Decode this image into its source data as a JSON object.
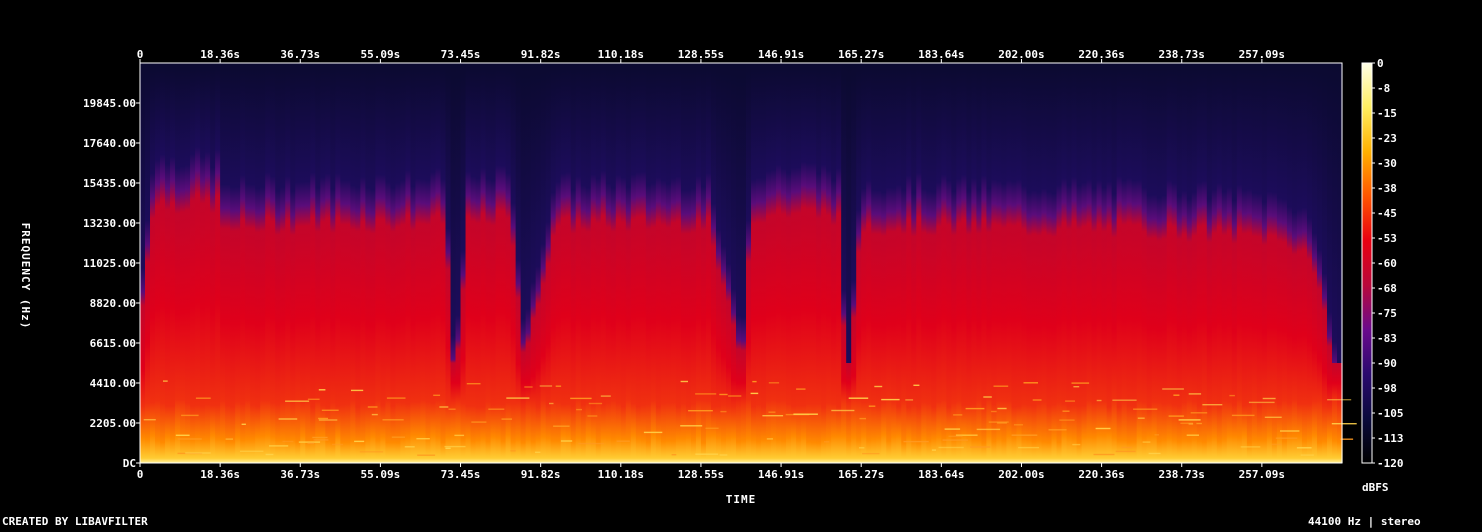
{
  "chart_data": {
    "type": "heatmap",
    "title": "",
    "xlabel": "TIME",
    "ylabel": "FREQUENCY (Hz)",
    "x_ticks": [
      "0",
      "18.36s",
      "36.73s",
      "55.09s",
      "73.45s",
      "91.82s",
      "110.18s",
      "128.55s",
      "146.91s",
      "165.27s",
      "183.64s",
      "202.00s",
      "220.36s",
      "238.73s",
      "257.09s"
    ],
    "y_ticks": [
      "DC",
      "2205.00",
      "4410.00",
      "6615.00",
      "8820.00",
      "11025.00",
      "13230.00",
      "15435.00",
      "17640.00",
      "19845.00"
    ],
    "xlim": [
      0,
      275.3
    ],
    "ylim": [
      0,
      22050
    ],
    "colorbar": {
      "label": "dBFS",
      "ticks": [
        "0",
        "-8",
        "-15",
        "-23",
        "-30",
        "-38",
        "-45",
        "-53",
        "-60",
        "-68",
        "-75",
        "-83",
        "-90",
        "-98",
        "-105",
        "-113",
        "-120"
      ],
      "range": [
        -120,
        0
      ],
      "colors": [
        "#000000",
        "#0a0a3c",
        "#2a0a6e",
        "#6a0a8c",
        "#b8083a",
        "#e80010",
        "#ff5500",
        "#ffb000",
        "#ffee60",
        "#ffffe8"
      ]
    },
    "bandwidth_profile": {
      "time_s": [
        0,
        3,
        6,
        12,
        18,
        19,
        22,
        30,
        50,
        70,
        72,
        75,
        85,
        88,
        95,
        110,
        130,
        138,
        140,
        150,
        160,
        162,
        165,
        180,
        200,
        220,
        240,
        250,
        260,
        268,
        272,
        275
      ],
      "cutoff_hz": [
        8000,
        15500,
        15500,
        15500,
        15500,
        13800,
        14000,
        14200,
        14300,
        14400,
        4000,
        14200,
        14800,
        6000,
        14200,
        14300,
        14300,
        6000,
        14800,
        15000,
        14800,
        3000,
        14200,
        14100,
        14000,
        14000,
        13800,
        13600,
        13400,
        12500,
        8000,
        3000
      ]
    }
  },
  "footer": {
    "left": "CREATED BY LIBAVFILTER",
    "right": "44100 Hz | stereo"
  }
}
